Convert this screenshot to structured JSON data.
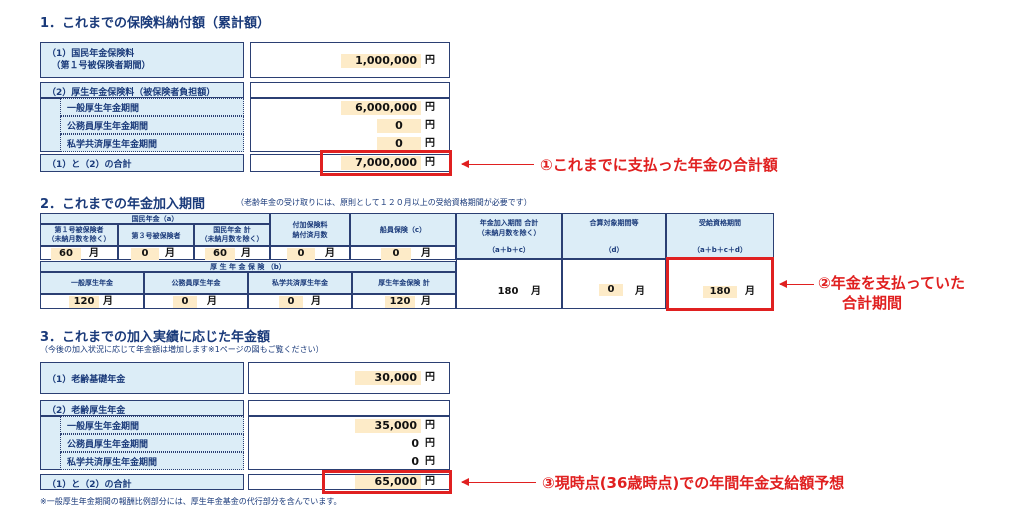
{
  "section1": {
    "title": "1．これまでの保険料納付額（累計額）",
    "rows": [
      {
        "label": "（1）国民年金保険料\n　（第１号被保険者期間）",
        "value": "1,000,000",
        "unit": "円"
      },
      {
        "label": "（2）厚生年金保険料（被保険者負担額）"
      },
      {
        "label": "一般厚生年金期間",
        "value": "6,000,000",
        "unit": "円"
      },
      {
        "label": "公務員厚生年金期間",
        "value": "0",
        "unit": "円"
      },
      {
        "label": "私学共済厚生年金期間",
        "value": "0",
        "unit": "円"
      },
      {
        "label": "（1）と（2）の合計",
        "value": "7,000,000",
        "unit": "円"
      }
    ]
  },
  "section2": {
    "title": "2．これまでの年金加入期間",
    "note": "（老齢年金の受け取りには、原則として１２０月以上の受給資格期間が必要です）",
    "kokumin_header": "国民年金（a）",
    "col1": "第１号被保険者\n（未納月数を除く）",
    "col2": "第３号被保険者",
    "col3": "国民年金 計\n（未納月数を除く）",
    "col4": "付加保険料\n納付済月数",
    "col5": "船員保険（c）",
    "col6": "年金加入期間 合計\n（未納月数を除く）",
    "col6b": "（a＋b＋c）",
    "col7": "合算対象期間等",
    "col7b": "（d）",
    "col8": "受給資格期間",
    "col8b": "（a＋b＋c＋d）",
    "kosei_header": "厚 生 年 金 保 険 （b）",
    "kcol1": "一般厚生年金",
    "kcol2": "公務員厚生年金",
    "kcol3": "私学共済厚生年金",
    "kcol4": "厚生年金保険 計",
    "v1": "60",
    "v2": "0",
    "v3": "60",
    "v4": "0",
    "v5": "0",
    "k1": "120",
    "k2": "0",
    "k3": "0",
    "k4": "120",
    "total": "180",
    "gassan": "0",
    "jukyu": "180",
    "month": "月"
  },
  "section3": {
    "title": "3．これまでの加入実績に応じた年金額",
    "subtitle": "（今後の加入状況に応じて年金額は増加します※1ページの図もご覧ください）",
    "rows": [
      {
        "label": "（1）老齢基礎年金",
        "value": "30,000",
        "unit": "円"
      },
      {
        "label": "（2）老齢厚生年金"
      },
      {
        "label": "一般厚生年金期間",
        "value": "35,000",
        "unit": "円"
      },
      {
        "label": "公務員厚生年金期間",
        "value": "0",
        "unit": "円"
      },
      {
        "label": "私学共済厚生年金期間",
        "value": "0",
        "unit": "円"
      },
      {
        "label": "（1）と（2）の合計",
        "value": "65,000",
        "unit": "円"
      }
    ],
    "footnote": "※一般厚生年金期間の報酬比例部分には、厚生年金基金の代行部分を含んでいます。"
  },
  "annotations": {
    "a1": "①これまでに支払った年金の合計額",
    "a2_line1": "②年金を支払っていた",
    "a2_line2": "合計期間",
    "a3": "③現時点(36歳時点)での年間年金支給額予想"
  }
}
